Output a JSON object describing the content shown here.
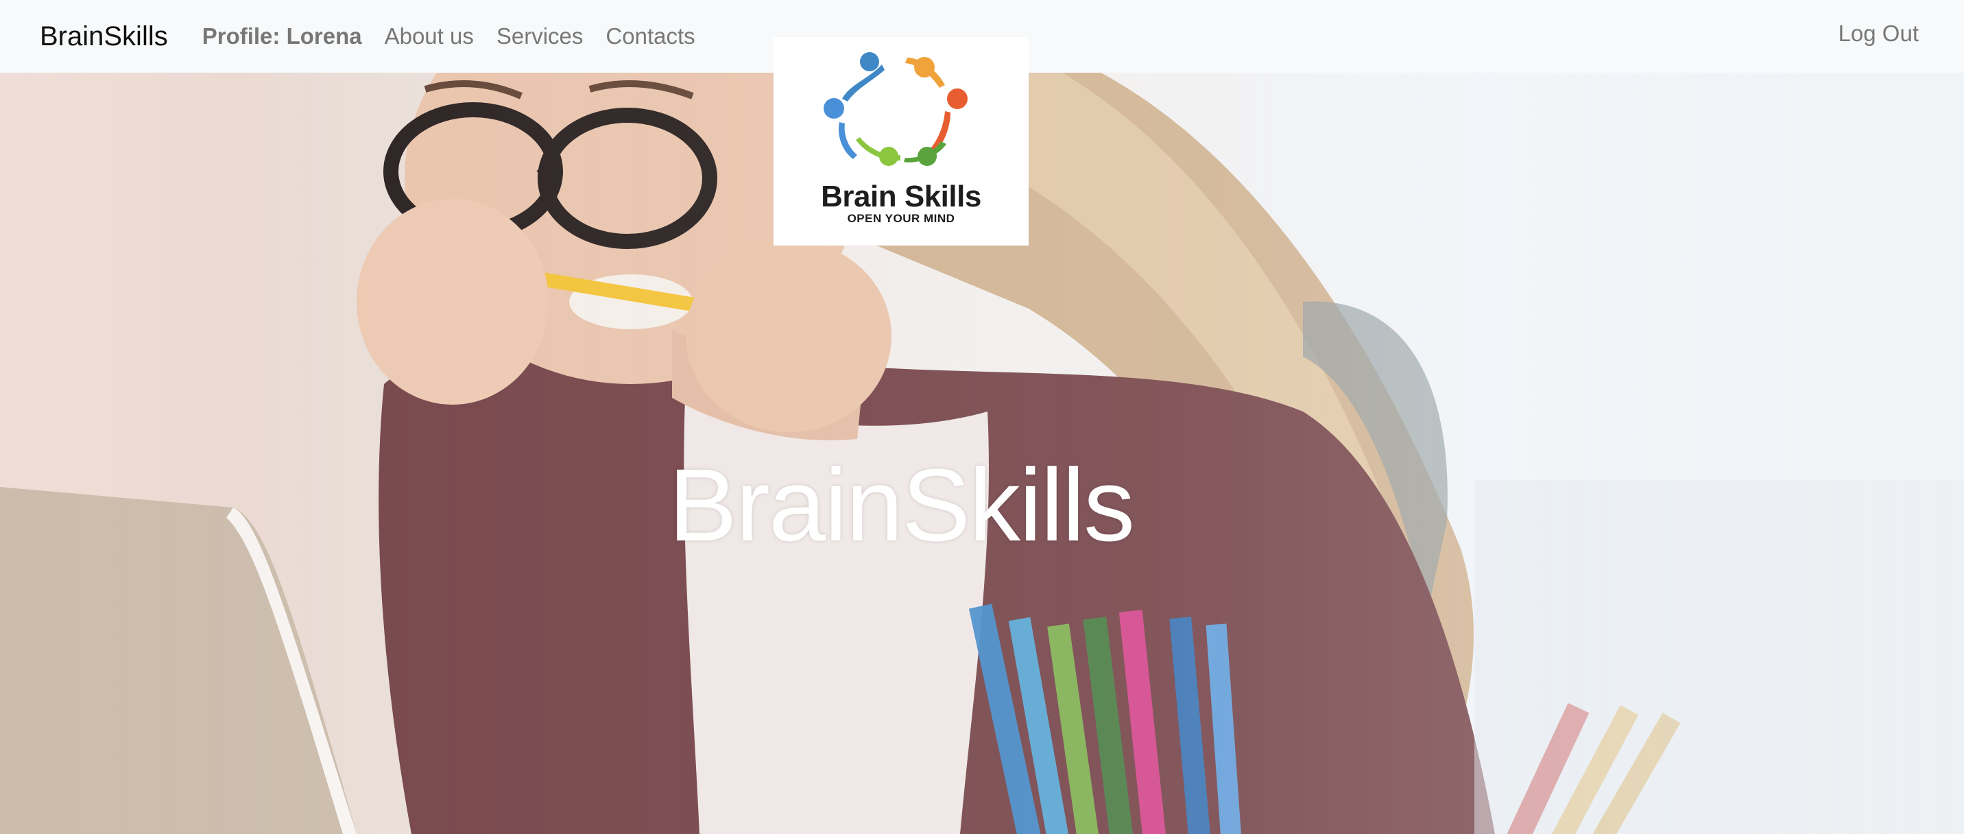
{
  "navbar": {
    "brand": "BrainSkills",
    "profile_label": "Profile: Lorena",
    "links": [
      "About us",
      "Services",
      "Contacts"
    ],
    "logout_label": "Log Out"
  },
  "logo": {
    "title": "Brain Skills",
    "tagline": "OPEN YOUR MIND",
    "colors": [
      "#3f88c5",
      "#f0a23b",
      "#e85d2f",
      "#8cc63f",
      "#5aa33c",
      "#4a90d9"
    ]
  },
  "hero": {
    "title": "BrainSkills",
    "image": "woman-biting-pencil-at-laptop-photo"
  }
}
